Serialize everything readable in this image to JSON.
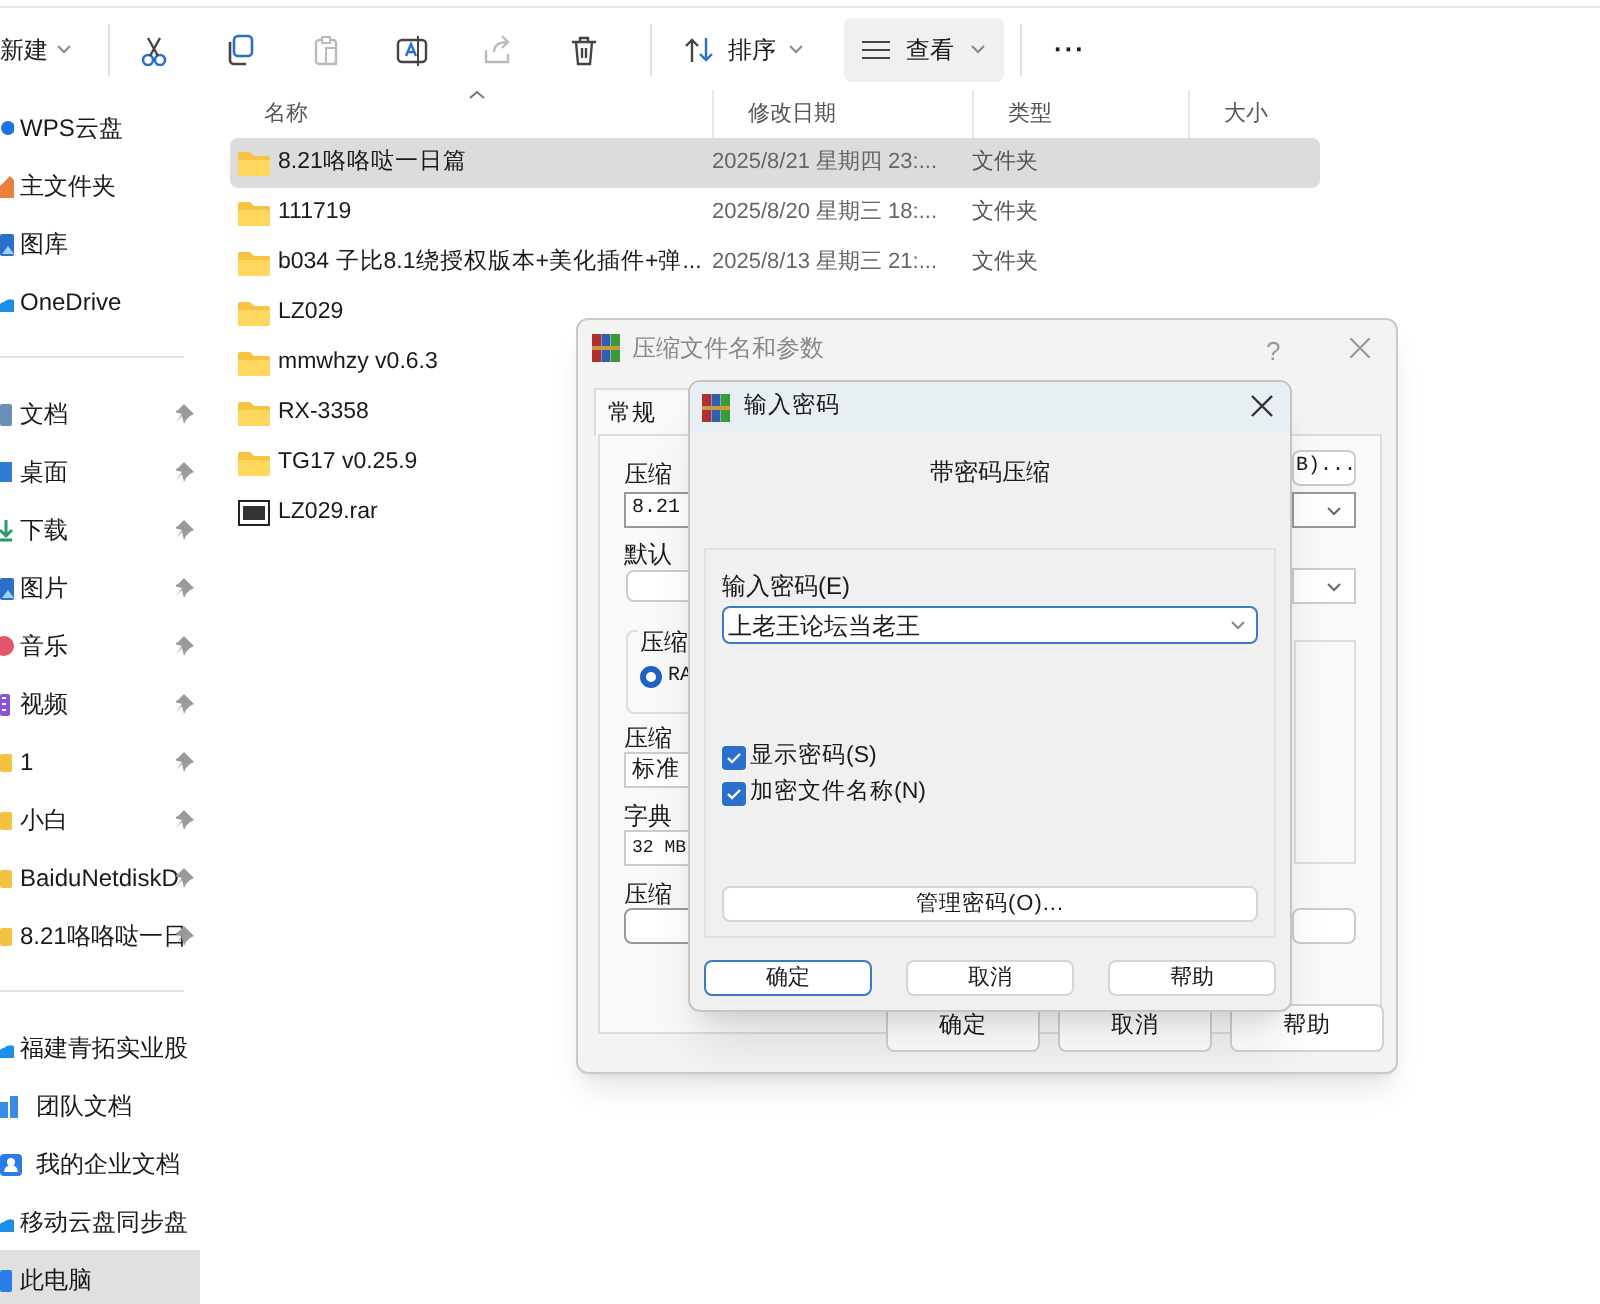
{
  "toolbar": {
    "new_label": "新建",
    "sort_label": "排序",
    "view_label": "查看",
    "more_label": "···"
  },
  "sidebar": {
    "sections": [
      {
        "items": [
          {
            "label": "WPS云盘",
            "kind": "dot",
            "pinned": false,
            "selected": false
          },
          {
            "label": "主文件夹",
            "kind": "home",
            "pinned": false,
            "selected": false
          },
          {
            "label": "图库",
            "kind": "gallery",
            "pinned": false,
            "selected": false
          },
          {
            "label": "OneDrive",
            "kind": "cloud",
            "pinned": false,
            "selected": false
          }
        ]
      },
      {
        "items": [
          {
            "label": "文档",
            "kind": "doc",
            "pinned": true,
            "selected": false
          },
          {
            "label": "桌面",
            "kind": "desktop",
            "pinned": true,
            "selected": false
          },
          {
            "label": "下载",
            "kind": "download",
            "pinned": true,
            "selected": false
          },
          {
            "label": "图片",
            "kind": "gallery",
            "pinned": true,
            "selected": false
          },
          {
            "label": "音乐",
            "kind": "music",
            "pinned": true,
            "selected": false
          },
          {
            "label": "视频",
            "kind": "video",
            "pinned": true,
            "selected": false
          },
          {
            "label": "1",
            "kind": "folder",
            "pinned": true,
            "selected": false
          },
          {
            "label": "小白",
            "kind": "folder",
            "pinned": true,
            "selected": false
          },
          {
            "label": "BaiduNetdiskD",
            "kind": "folder",
            "pinned": true,
            "selected": false
          },
          {
            "label": "8.21咯咯哒一日",
            "kind": "folder",
            "pinned": true,
            "selected": false
          }
        ]
      },
      {
        "items": [
          {
            "label": "福建青拓实业股",
            "kind": "cloud",
            "pinned": false,
            "selected": false
          },
          {
            "label": "团队文档",
            "kind": "team",
            "pinned": false,
            "selected": false
          },
          {
            "label": "我的企业文档",
            "kind": "person",
            "pinned": false,
            "selected": false
          },
          {
            "label": "移动云盘同步盘",
            "kind": "cloud",
            "pinned": false,
            "selected": false
          },
          {
            "label": "此电脑",
            "kind": "pc",
            "pinned": false,
            "selected": true
          }
        ]
      }
    ]
  },
  "file_list": {
    "columns": [
      "名称",
      "修改日期",
      "类型",
      "大小"
    ],
    "rows": [
      {
        "name": "8.21咯咯哒一日篇",
        "modified": "2025/8/21 星期四 23:...",
        "type": "文件夹",
        "kind": "folder",
        "selected": true
      },
      {
        "name": "111719",
        "modified": "2025/8/20 星期三 18:...",
        "type": "文件夹",
        "kind": "folder",
        "selected": false
      },
      {
        "name": "b034 子比8.1绕授权版本+美化插件+弹...",
        "modified": "2025/8/13 星期三 21:...",
        "type": "文件夹",
        "kind": "folder",
        "selected": false
      },
      {
        "name": "LZ029",
        "kind": "folder",
        "selected": false
      },
      {
        "name": "mmwhzy v0.6.3",
        "kind": "folder",
        "selected": false
      },
      {
        "name": "RX-3358",
        "kind": "folder",
        "selected": false
      },
      {
        "name": "TG17 v0.25.9",
        "kind": "folder",
        "selected": false
      },
      {
        "name": "LZ029.rar",
        "kind": "archive",
        "selected": false
      }
    ]
  },
  "archive_dialog": {
    "title": "压缩文件名和参数",
    "help": "?",
    "tab": "常规",
    "browse_button": "B)...",
    "archive_name_label": "压缩",
    "archive_name_value": "8.21",
    "profile_label": "默认",
    "format_group": "压缩",
    "format_radio": {
      "label": "RA",
      "selected": true
    },
    "method_label": "压缩",
    "method_value": "标准",
    "dict_label": "字典",
    "dict_value": "32 MB",
    "split_label": "压缩",
    "buttons": [
      "确定",
      "取消",
      "帮助"
    ]
  },
  "password_dialog": {
    "title": "输入密码",
    "heading": "带密码压缩",
    "password_label": "输入密码(E)",
    "password_value": "上老王论坛当老王",
    "options": [
      {
        "label": "显示密码(S)",
        "checked": true
      },
      {
        "label": "加密文件名称(N)",
        "checked": true
      }
    ],
    "manage_button": "管理密码(O)...",
    "buttons": [
      {
        "label": "确定",
        "selected": true
      },
      {
        "label": "取消",
        "selected": false
      },
      {
        "label": "帮助",
        "selected": false
      }
    ]
  }
}
